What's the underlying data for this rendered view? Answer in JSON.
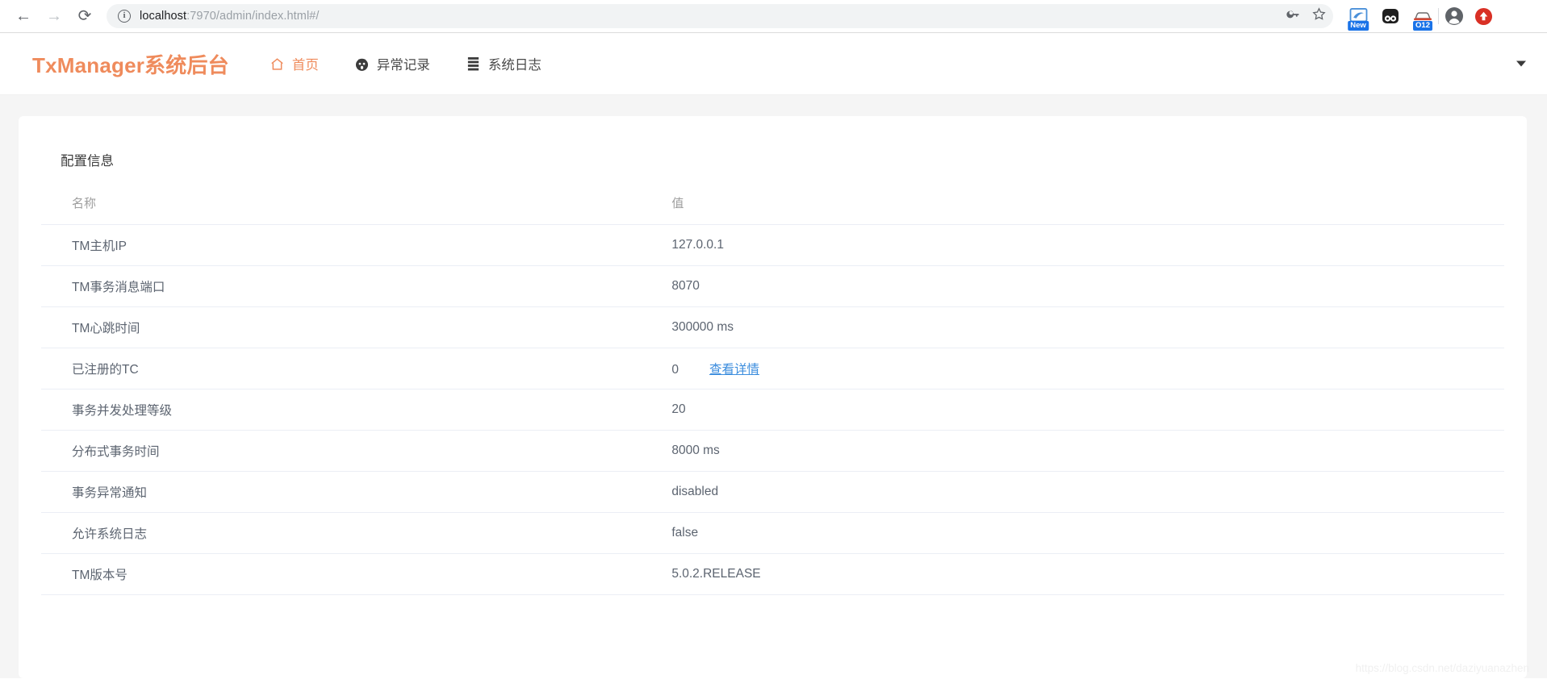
{
  "browser": {
    "back_icon": "back-arrow-icon",
    "forward_icon": "forward-arrow-icon",
    "reload_icon": "reload-icon",
    "site_info_icon": "info-circle-icon",
    "url_host": "localhost",
    "url_path": ":7970/admin/index.html#/",
    "url_full": "localhost:7970/admin/index.html#/",
    "password_icon": "key-icon",
    "bookmark_icon": "star-icon",
    "extensions": [
      {
        "name": "clipper-extension-icon",
        "badge": "New"
      },
      {
        "name": "panda-extension-icon",
        "badge": ""
      },
      {
        "name": "opera-extension-icon",
        "badge": "O12"
      }
    ],
    "profile_icon": "account-avatar-icon",
    "update_icon": "update-available-icon"
  },
  "app": {
    "brand": "TxManager系统后台",
    "nav_items": [
      {
        "label": "首页",
        "icon": "home-icon",
        "active": true
      },
      {
        "label": "异常记录",
        "icon": "exception-face-icon",
        "active": false
      },
      {
        "label": "系统日志",
        "icon": "log-list-icon",
        "active": false
      }
    ],
    "user_menu_caret": "chevron-down-icon"
  },
  "card": {
    "title": "配置信息",
    "columns": [
      "名称",
      "值"
    ],
    "rows": [
      {
        "name": "TM主机IP",
        "value": "127.0.0.1",
        "link": ""
      },
      {
        "name": "TM事务消息端口",
        "value": "8070",
        "link": ""
      },
      {
        "name": "TM心跳时间",
        "value": "300000 ms",
        "link": ""
      },
      {
        "name": "已注册的TC",
        "value": "0",
        "link": "查看详情"
      },
      {
        "name": "事务并发处理等级",
        "value": "20",
        "link": ""
      },
      {
        "name": "分布式事务时间",
        "value": "8000 ms",
        "link": ""
      },
      {
        "name": "事务异常通知",
        "value": "disabled",
        "link": ""
      },
      {
        "name": "允许系统日志",
        "value": "false",
        "link": ""
      },
      {
        "name": "TM版本号",
        "value": "5.0.2.RELEASE",
        "link": ""
      }
    ]
  },
  "watermark": "https://blog.csdn.net/daziyuanazhen",
  "colors": {
    "brand": "#ef8b5c",
    "link": "#3d8ede",
    "page_bg": "#f5f5f5",
    "text": "#5c6470",
    "muted": "#9e9e9e"
  }
}
